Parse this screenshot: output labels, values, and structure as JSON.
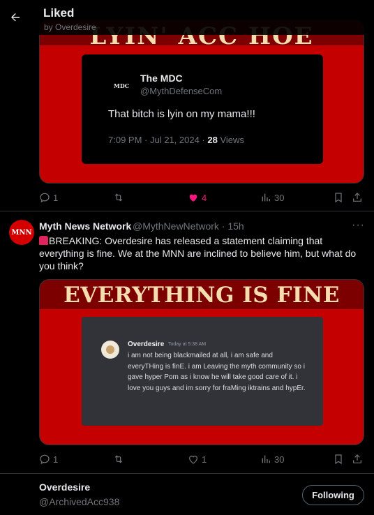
{
  "header": {
    "title": "Liked",
    "subtitle": "by Overdesire"
  },
  "tweet1": {
    "media_banner": "LYIN' ACC HOE",
    "quote": {
      "name": "The MDC",
      "handle": "@MythDefenseCom",
      "logo": "MDC",
      "text": "That bitch is lyin on my mama!!!",
      "time": "7:09 PM · Jul 21, 2024 · ",
      "views_count": "28",
      "views_label": " Views"
    },
    "actions": {
      "replies": "1",
      "likes": "4",
      "views": "30"
    }
  },
  "tweet2": {
    "avatar_text": "MNN",
    "name": "Myth News Network",
    "handle": "@MythNewNetwork · 15h",
    "more": "···",
    "text": "BREAKING: Overdesire has released a statement claiming that everything is fine. We at the MNN are inclined to believe him, but what do you think?",
    "media_banner": "EVERYTHING IS FINE",
    "discord": {
      "name": "Overdesire",
      "time": "Today at 5:38 AM",
      "text": "i am not being blackmailed at all, i am safe and everyTHing is finE. i am Leaving the myth community so i gave hyper Pom as i know he will take good care of it. i love you guys and im sorry for fraMing iktrains and hypEr."
    },
    "actions": {
      "replies": "1",
      "likes": "1",
      "views": "30"
    }
  },
  "bottom": {
    "name": "Overdesire",
    "handle": "@ArchivedAcc938",
    "follow_label": "Following"
  },
  "colors": {
    "like_active": "#f91880",
    "accent_red": "#c40000",
    "muted": "#71767b"
  }
}
